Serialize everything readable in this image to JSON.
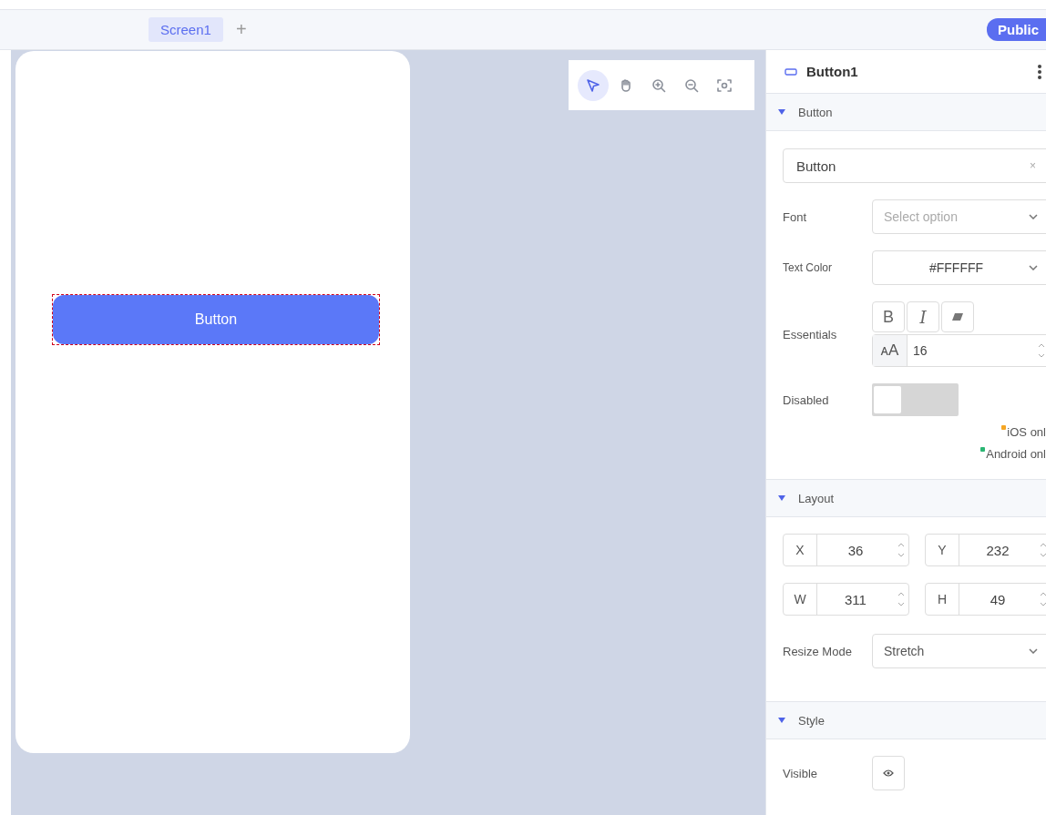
{
  "tabs": [
    {
      "label": "Screen1",
      "selected": true
    }
  ],
  "add_tab": "+",
  "publish_button": "Public",
  "toolbar": [
    {
      "kind": "select",
      "selected": true
    },
    {
      "kind": "pan",
      "selected": false
    },
    {
      "kind": "zoom-in",
      "selected": false
    },
    {
      "kind": "zoom-out",
      "selected": false
    },
    {
      "kind": "fit",
      "selected": false
    }
  ],
  "canvas": {
    "button": {
      "label": "Button",
      "selected": true
    }
  },
  "inspector": {
    "title": "Button1",
    "button_section": {
      "header": "Button",
      "expanded": true,
      "text_value": "Button",
      "clear": "×",
      "font_label": "Font",
      "font_placeholder": "Select option",
      "text_color_label": "Text Color",
      "text_color_value": "#FFFFFF",
      "essentials_label": "Essentials",
      "bold": "B",
      "italic": "I",
      "size_glyph": "ᴀA",
      "size_value": "16",
      "disabled_label": "Disabled",
      "disabled_on": false,
      "notes": [
        {
          "text": "iOS onl",
          "color": "#f5a623"
        },
        {
          "text": "Android onl",
          "color": "#2bb673"
        }
      ]
    },
    "layout_section": {
      "header": "Layout",
      "expanded": true,
      "fields": [
        {
          "label": "X",
          "value": "36"
        },
        {
          "label": "Y",
          "value": "232"
        },
        {
          "label": "W",
          "value": "311"
        },
        {
          "label": "H",
          "value": "49"
        }
      ],
      "resize_label": "Resize Mode",
      "resize_value": "Stretch"
    },
    "style_section": {
      "header": "Style",
      "expanded": true,
      "visible_label": "Visible"
    }
  }
}
